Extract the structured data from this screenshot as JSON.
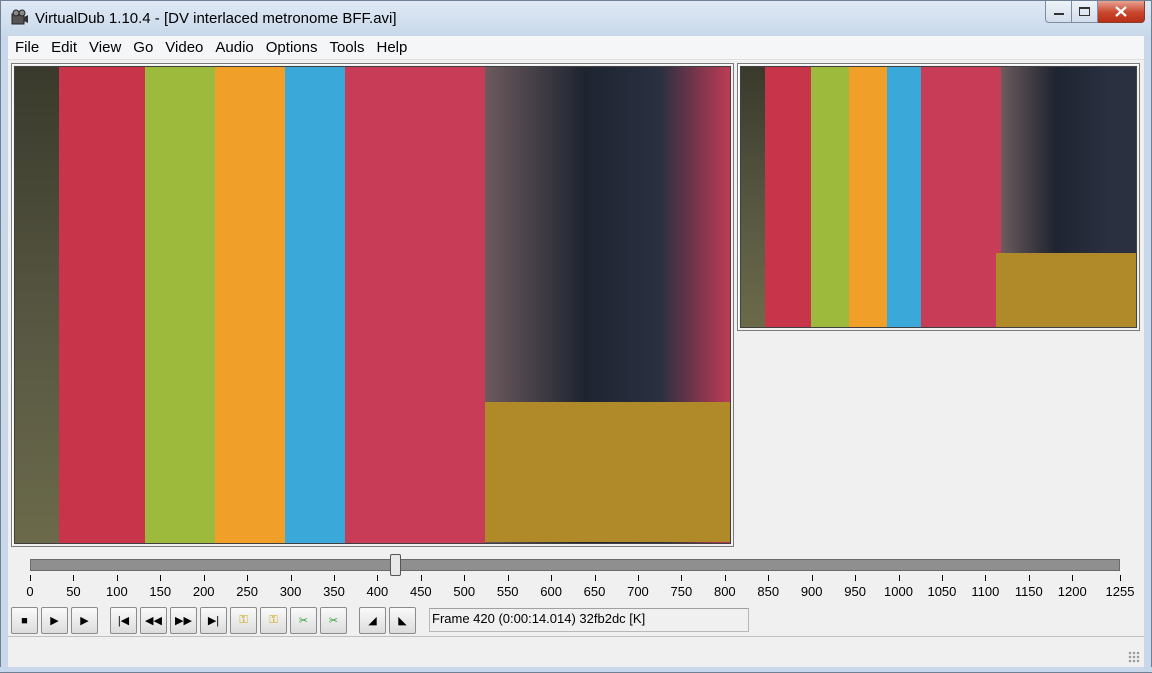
{
  "window": {
    "title": "VirtualDub 1.10.4 - [DV interlaced metronome BFF.avi]",
    "app_icon": "film-camera-icon"
  },
  "menu": [
    "File",
    "Edit",
    "View",
    "Go",
    "Video",
    "Audio",
    "Options",
    "Tools",
    "Help"
  ],
  "timeline": {
    "ticks": [
      "0",
      "50",
      "100",
      "150",
      "200",
      "250",
      "300",
      "350",
      "400",
      "450",
      "500",
      "550",
      "600",
      "650",
      "700",
      "750",
      "800",
      "850",
      "900",
      "950",
      "1000",
      "1050",
      "1100",
      "1150",
      "1200",
      "1255"
    ],
    "min": 0,
    "max": 1255,
    "position": 420
  },
  "toolbar": {
    "buttons": [
      {
        "icon": "stop-icon",
        "glyph": "■"
      },
      {
        "icon": "play-input-icon",
        "glyph": "▶"
      },
      {
        "icon": "play-output-icon",
        "glyph": "▶"
      },
      {
        "icon": "go-start-icon",
        "glyph": "|◀"
      },
      {
        "icon": "step-back-icon",
        "glyph": "◀◀"
      },
      {
        "icon": "step-forward-icon",
        "glyph": "▶▶"
      },
      {
        "icon": "go-end-icon",
        "glyph": "▶|"
      },
      {
        "icon": "prev-keyframe-icon",
        "glyph": "⚿"
      },
      {
        "icon": "next-keyframe-icon",
        "glyph": "⚿"
      },
      {
        "icon": "prev-scene-icon",
        "glyph": "✂"
      },
      {
        "icon": "next-scene-icon",
        "glyph": "✂"
      },
      {
        "icon": "mark-in-icon",
        "glyph": "◢"
      },
      {
        "icon": "mark-out-icon",
        "glyph": "◣"
      }
    ],
    "frame_status": "Frame 420 (0:00:14.014) 32fb2dc [K]"
  },
  "colors": {
    "box_red": "#c8344a",
    "box_green": "#9dba3c",
    "box_orange": "#f0a028",
    "box_blue": "#3aa8d8",
    "box_maroon": "#c83c58",
    "metronome": "#1e2430",
    "stand": "#b08a28"
  }
}
